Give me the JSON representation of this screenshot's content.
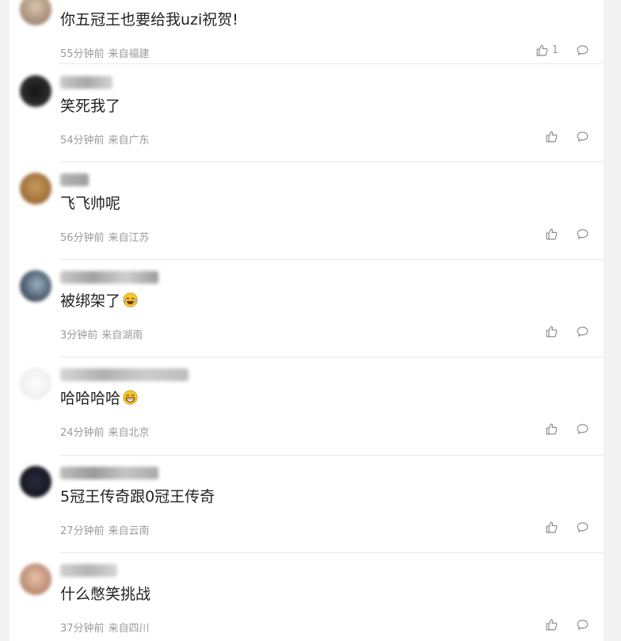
{
  "comments": [
    {
      "text": "你五冠王也要给我uzi祝贺!",
      "time": "55分钟前",
      "location": "来自福建",
      "likes": "1",
      "emoji": null
    },
    {
      "text": "笑死我了",
      "time": "54分钟前",
      "location": "来自广东",
      "likes": "",
      "emoji": null
    },
    {
      "text": "飞飞帅呢",
      "time": "56分钟前",
      "location": "来自江苏",
      "likes": "",
      "emoji": null
    },
    {
      "text": "被绑架了",
      "time": "3分钟前",
      "location": "来自湖南",
      "likes": "",
      "emoji": "laugh-cry-emoji"
    },
    {
      "text": "哈哈哈哈",
      "time": "24分钟前",
      "location": "来自北京",
      "likes": "",
      "emoji": "grin-emoji"
    },
    {
      "text": "5冠王传奇跟0冠王传奇",
      "time": "27分钟前",
      "location": "来自云南",
      "likes": "",
      "emoji": null
    },
    {
      "text": "什么憋笑挑战",
      "time": "37分钟前",
      "location": "来自四川",
      "likes": "",
      "emoji": null
    }
  ],
  "icons": {
    "like": "thumbs-up-icon",
    "reply": "comment-bubble-icon"
  },
  "colors": {
    "meta": "#9a9a9a",
    "text": "#222222",
    "divider": "#e8e8e8"
  }
}
